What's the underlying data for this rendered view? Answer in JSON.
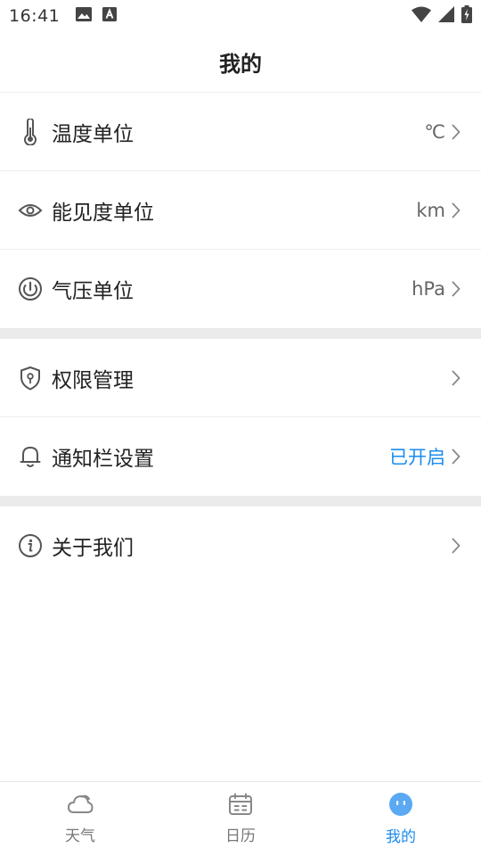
{
  "status_bar": {
    "time": "16:41",
    "left_icons": [
      "image-icon",
      "keyboard-a-icon"
    ],
    "right_icons": [
      "wifi-icon",
      "cellular-signal-icon",
      "battery-charging-icon"
    ]
  },
  "header": {
    "title": "我的"
  },
  "groups": [
    {
      "items": [
        {
          "icon": "thermometer-icon",
          "label": "温度单位",
          "value": "℃"
        },
        {
          "icon": "eye-icon",
          "label": "能见度单位",
          "value": "km"
        },
        {
          "icon": "gauge-icon",
          "label": "气压单位",
          "value": "hPa"
        }
      ]
    },
    {
      "items": [
        {
          "icon": "shield-lock-icon",
          "label": "权限管理",
          "value": ""
        },
        {
          "icon": "bell-icon",
          "label": "通知栏设置",
          "value": "已开启"
        }
      ]
    },
    {
      "items": [
        {
          "icon": "info-icon",
          "label": "关于我们",
          "value": ""
        }
      ]
    }
  ],
  "tab_bar": {
    "tabs": [
      {
        "icon": "cloud-icon",
        "label": "天气",
        "active": false
      },
      {
        "icon": "calendar-icon",
        "label": "日历",
        "active": false
      },
      {
        "icon": "face-icon",
        "label": "我的",
        "active": true
      }
    ]
  },
  "colors": {
    "accent": "#1a8cf0",
    "icon_gray": "#555555",
    "divider": "#eeeeee",
    "group_gap": "#ebebeb"
  }
}
